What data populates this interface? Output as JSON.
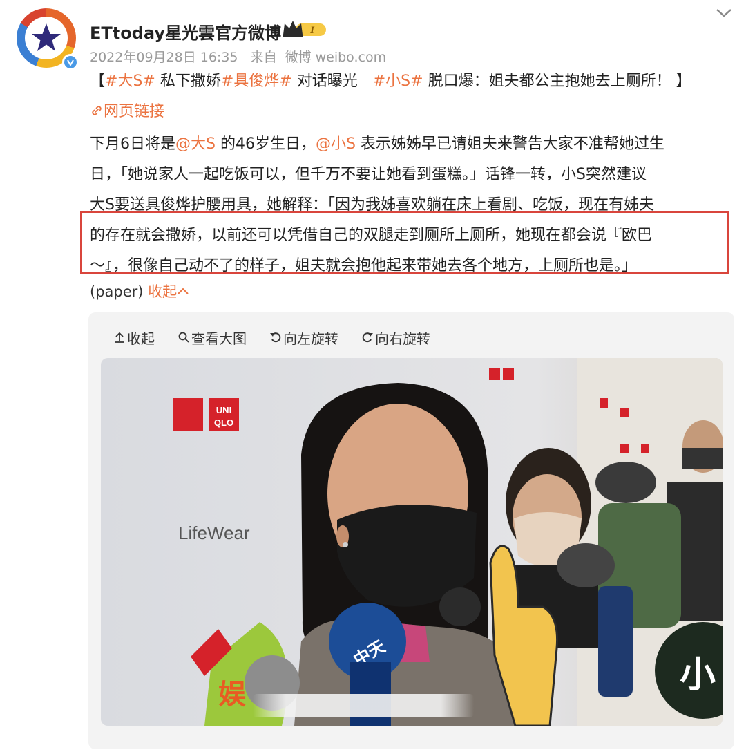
{
  "post": {
    "author_name": "ETtoday星光雲官方微博",
    "vip_level": "I",
    "timestamp": "2022年09月28日 16:35",
    "source_prefix": "来自",
    "source_name": "微博 weibo.com",
    "title": {
      "open_bracket": "【",
      "topic_1": "#大S#",
      "text_1": " 私下撒娇",
      "topic_2": "#具俊烨#",
      "text_2": " 对话曝光　",
      "topic_3": "#小S#",
      "text_3": " 脱口爆：姐夫都公主抱她去上厕所！",
      "close_bracket": " 】"
    },
    "web_link_label": "网页链接",
    "body": {
      "line_1_a": "下月6日将是",
      "mention_1": "@大S",
      "line_1_b": " 的46岁生日，",
      "mention_2": "@小S",
      "line_1_c": " 表示姊姊早已请姐夫来警告大家不准帮她过生",
      "line_2": "日，「她说家人一起吃饭可以，但千万不要让她看到蛋糕。」话锋一转，小S突然建议",
      "line_3": "大S要送具俊烨护腰用具，她解释：「因为我姊喜欢躺在床上看剧、吃饭，现在有姊夫",
      "line_4": "的存在就会撒娇，以前还可以凭借自己的双腿走到厕所上厕所，她现在都会说『欧巴",
      "line_5": "～』，很像自己动不了的样子，姐夫就会抱他起来带她去各个地方，上厕所也是。」"
    },
    "emoticon": "(paper)",
    "collapse_label": "收起"
  },
  "media_toolbar": {
    "collapse": "收起",
    "view_large": "查看大图",
    "rotate_left": "向左旋转",
    "rotate_right": "向右旋转"
  },
  "photo": {
    "backdrop_text": "LifeWear",
    "brand_text_1": "UNI",
    "brand_text_2": "QLO",
    "mic_text": "中天"
  },
  "colors": {
    "accent": "#eb7340",
    "highlight_border": "#d9453c",
    "verified": "#4a9ae6",
    "uniqlo_red": "#d5222a"
  }
}
